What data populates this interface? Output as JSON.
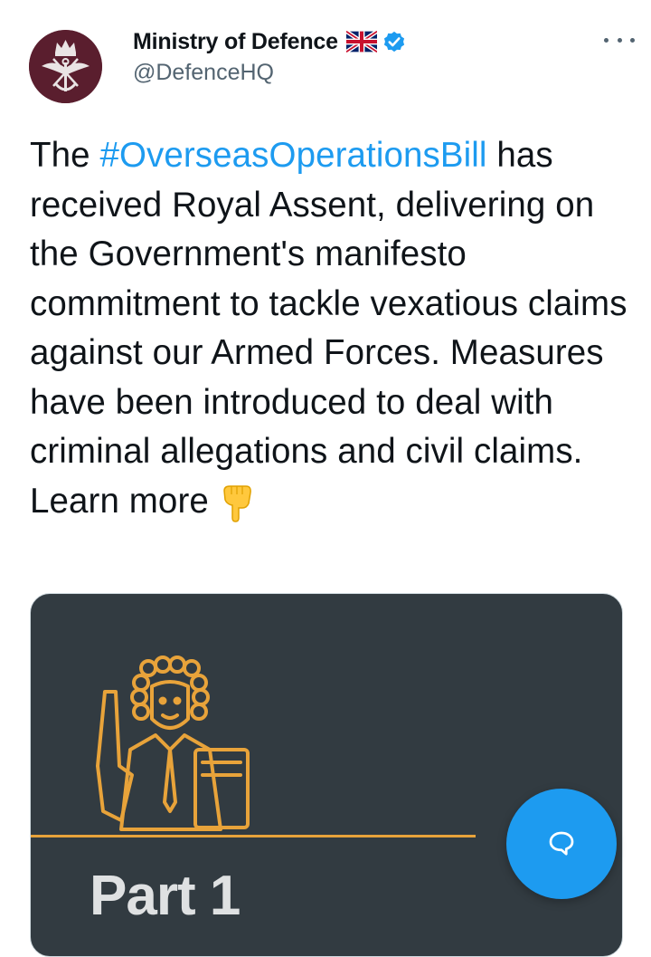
{
  "tweet": {
    "author_name": "Ministry of Defence",
    "author_handle": "@DefenceHQ",
    "text_before": "The ",
    "hashtag": "#OverseasOperationsBill",
    "text_after": " has received Royal Assent, delivering on the Government's manifesto commitment to tackle vexatious claims against our Armed Forces. Measures have been introduced to deal with criminal allegations and civil claims. Learn more",
    "emoji": "backhand-index-pointing-down"
  },
  "media": {
    "caption": "Part 1",
    "accent_color": "#e8a33a",
    "background_color": "#323b41"
  },
  "colors": {
    "link": "#1d9bf0",
    "verified": "#1d9bf0",
    "secondary_text": "#536471"
  },
  "icons": {
    "avatar": "ministry-of-defence-crest",
    "flag": "uk-flag-icon",
    "verified": "verified-badge-icon",
    "more": "more-options-icon",
    "fab": "compose-reply-icon"
  }
}
